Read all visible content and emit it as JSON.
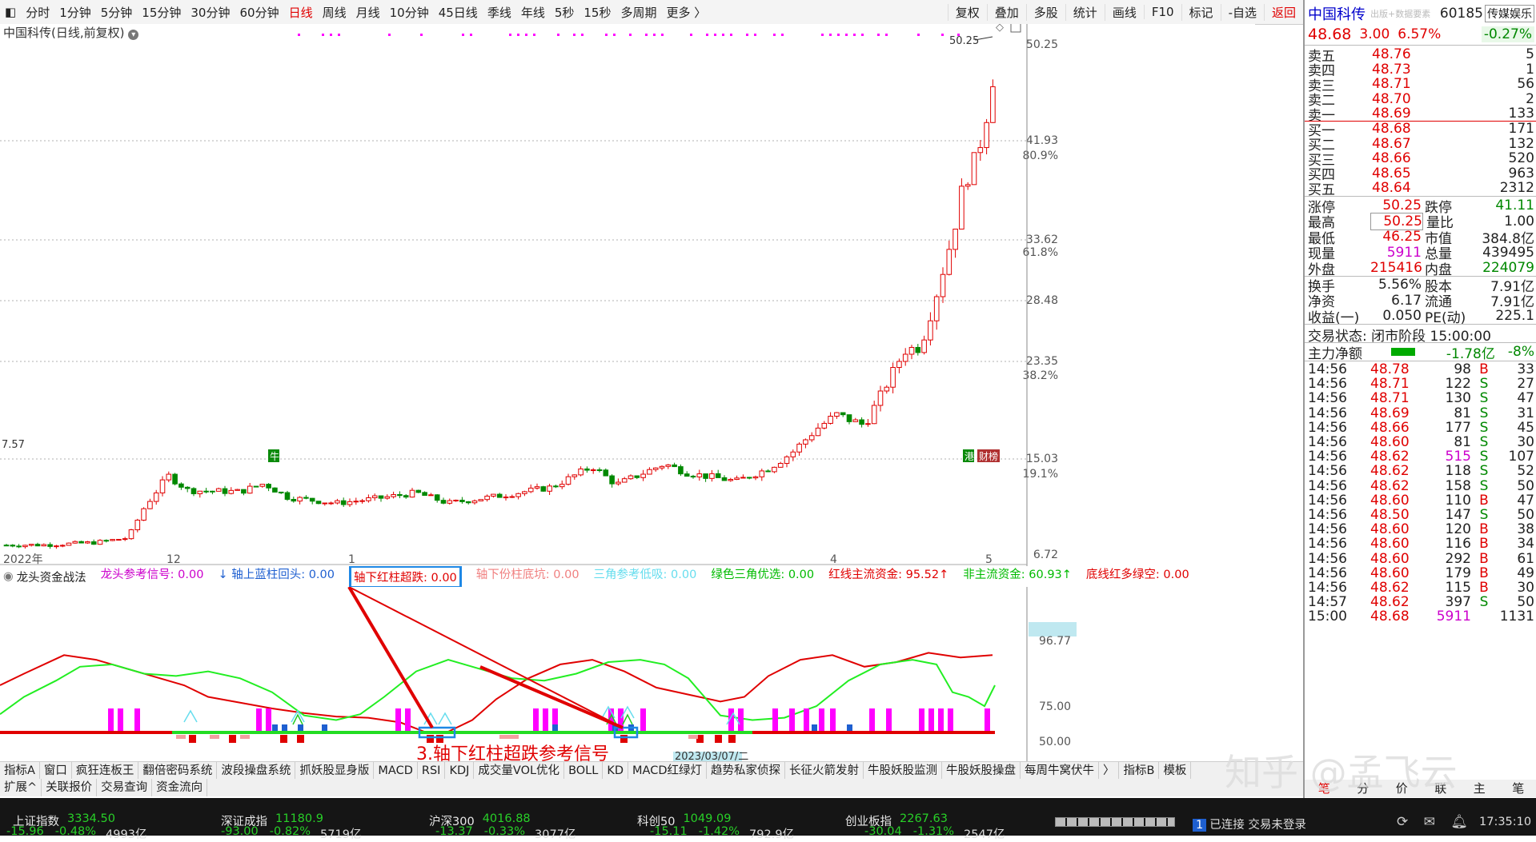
{
  "toolbar": {
    "periods": [
      "分时",
      "1分钟",
      "5分钟",
      "15分钟",
      "30分钟",
      "60分钟",
      "日线",
      "周线",
      "月线",
      "10分钟",
      "45日线",
      "季线",
      "年线",
      "5秒",
      "15秒",
      "多周期",
      "更多 〉"
    ],
    "active": "日线",
    "right_tools": [
      "复权",
      "叠加",
      "多股",
      "统计",
      "画线",
      "F10",
      "标记",
      "-自选",
      "返回"
    ]
  },
  "chart": {
    "title": "中国科传(日线,前复权)",
    "price_labels": [
      "50.25",
      "41.93",
      "33.62",
      "28.48",
      "23.35",
      "15.03",
      "6.72"
    ],
    "pct_labels": [
      "80.9%",
      "61.8%",
      "38.2%",
      "19.1%"
    ],
    "high_marker": "50.25",
    "low_marker": "7.57",
    "date_labels": [
      "2022年",
      "12",
      "1",
      "4",
      "5"
    ],
    "cursor_date": "2023/03/07/二",
    "badges": {
      "bull": "牛",
      "gang": "港",
      "cai": "财榜"
    }
  },
  "indicator": {
    "name": "龙头资金战法",
    "items": [
      {
        "label": "龙头参考信号: 0.00",
        "color": "#cc00cc"
      },
      {
        "label": "↓ 轴上蓝柱回头: 0.00",
        "color": "#1e5fd0"
      },
      {
        "label": "轴下红柱超跌: 0.00",
        "color": "#e00000"
      },
      {
        "label": "轴下份柱底坑: 0.00",
        "color": "#f08080"
      },
      {
        "label": "三角参考低吸: 0.00",
        "color": "#66ddee"
      },
      {
        "label": "绿色三角优选: 0.00",
        "color": "#00bb00"
      },
      {
        "label": "红线主流资金: 95.52↑",
        "color": "#e00000"
      },
      {
        "label": "非主流资金: 60.93↑",
        "color": "#00bb00"
      },
      {
        "label": "底线红多绿空: 0.00",
        "color": "#e00000"
      }
    ],
    "value_labels": [
      "96.77",
      "75.00",
      "50.00"
    ],
    "annotation": "3.轴下红柱超跌参考信号"
  },
  "tabs1": [
    "指标A",
    "窗口",
    "疯狂连板王",
    "翻倍密码系统",
    "波段操盘系统",
    "抓妖股显身版",
    "MACD",
    "RSI",
    "KDJ",
    "成交量VOL优化",
    "BOLL",
    "KD",
    "MACD红绿灯",
    "趋势私家侦探",
    "长征火箭发射",
    "牛股妖股监测",
    "牛股妖股操盘",
    "每周牛窝伏牛",
    "〉",
    "指标B",
    "模板"
  ],
  "tabs2": [
    "扩展^",
    "关联报价",
    "交易查询",
    "资金流向"
  ],
  "status": {
    "indices": [
      {
        "name": "上证指数",
        "value": "3334.50",
        "chg": "-15.96",
        "pct": "-0.48%",
        "amt": "4993亿"
      },
      {
        "name": "深证成指",
        "value": "11180.9",
        "chg": "-93.00",
        "pct": "-0.82%",
        "amt": "5719亿"
      },
      {
        "name": "沪深300",
        "value": "4016.88",
        "chg": "-13.37",
        "pct": "-0.33%",
        "amt": "3077亿"
      },
      {
        "name": "科创50",
        "value": "1049.09",
        "chg": "-15.11",
        "pct": "-1.42%",
        "amt": "792.9亿"
      },
      {
        "name": "创业板指",
        "value": "2267.63",
        "chg": "-30.04",
        "pct": "-1.31%",
        "amt": "2547亿"
      }
    ],
    "conn": "已连接 交易未登录",
    "time": "17:35:10",
    "conn_num": "1"
  },
  "quote": {
    "name": "中国科传",
    "code": "60185",
    "sector": "传媒娱乐",
    "sub": "出版+数据要素",
    "price": "48.68",
    "chg": "3.00",
    "pct": "6.57%",
    "sector_pct": "-0.27%",
    "asks": [
      {
        "l": "卖五",
        "p": "48.76",
        "v": "5"
      },
      {
        "l": "卖四",
        "p": "48.73",
        "v": "1"
      },
      {
        "l": "卖三",
        "p": "48.71",
        "v": "56"
      },
      {
        "l": "卖二",
        "p": "48.70",
        "v": "2"
      },
      {
        "l": "卖一",
        "p": "48.69",
        "v": "133"
      }
    ],
    "bids": [
      {
        "l": "买一",
        "p": "48.68",
        "v": "171"
      },
      {
        "l": "买二",
        "p": "48.67",
        "v": "132"
      },
      {
        "l": "买三",
        "p": "48.66",
        "v": "520"
      },
      {
        "l": "买四",
        "p": "48.65",
        "v": "963"
      },
      {
        "l": "买五",
        "p": "48.64",
        "v": "2312"
      }
    ],
    "stats": [
      [
        "涨停",
        "50.25",
        "跌停",
        "41.11"
      ],
      [
        "最高",
        "50.25",
        "量比",
        "1.00"
      ],
      [
        "最低",
        "46.25",
        "市值",
        "384.8亿"
      ],
      [
        "现量",
        "5911",
        "总量",
        "439495"
      ],
      [
        "外盘",
        "215416",
        "内盘",
        "224079"
      ]
    ],
    "stats2": [
      [
        "换手",
        "5.56%",
        "股本",
        "7.91亿"
      ],
      [
        "净资",
        "6.17",
        "流通",
        "7.91亿"
      ],
      [
        "收益(一)",
        "0.050",
        "PE(动)",
        "225.1"
      ]
    ],
    "state": "交易状态: 闭市阶段 15:00:00",
    "flow_label": "主力净额",
    "flow_val": "-1.78亿",
    "flow_pct": "-8%",
    "ticks": [
      [
        "14:56",
        "48.78",
        "98",
        "B",
        "33"
      ],
      [
        "14:56",
        "48.71",
        "122",
        "S",
        "27"
      ],
      [
        "14:56",
        "48.71",
        "130",
        "S",
        "47"
      ],
      [
        "14:56",
        "48.69",
        "81",
        "S",
        "31"
      ],
      [
        "14:56",
        "48.66",
        "177",
        "S",
        "45"
      ],
      [
        "14:56",
        "48.60",
        "81",
        "S",
        "30"
      ],
      [
        "14:56",
        "48.62",
        "515",
        "S",
        "107"
      ],
      [
        "14:56",
        "48.62",
        "118",
        "S",
        "52"
      ],
      [
        "14:56",
        "48.62",
        "158",
        "S",
        "50"
      ],
      [
        "14:56",
        "48.60",
        "110",
        "B",
        "47"
      ],
      [
        "14:56",
        "48.50",
        "147",
        "S",
        "50"
      ],
      [
        "14:56",
        "48.60",
        "120",
        "B",
        "38"
      ],
      [
        "14:56",
        "48.60",
        "116",
        "B",
        "34"
      ],
      [
        "14:56",
        "48.60",
        "292",
        "B",
        "61"
      ],
      [
        "14:56",
        "48.60",
        "179",
        "B",
        "49"
      ],
      [
        "14:56",
        "48.62",
        "115",
        "B",
        "30"
      ],
      [
        "14:57",
        "48.62",
        "397",
        "S",
        "50"
      ],
      [
        "15:00",
        "48.68",
        "5911",
        "",
        "1131"
      ]
    ],
    "bottom_tabs": [
      "笔",
      "分",
      "价",
      "联",
      "主",
      "笔"
    ]
  },
  "watermark": "知乎 @孟飞云",
  "colors": {
    "up": "#e00000",
    "down": "#008800",
    "ind_red": "#e00000",
    "ind_green": "#22ee22",
    "magenta": "#ff00ff",
    "blue": "#1e5fd0"
  }
}
